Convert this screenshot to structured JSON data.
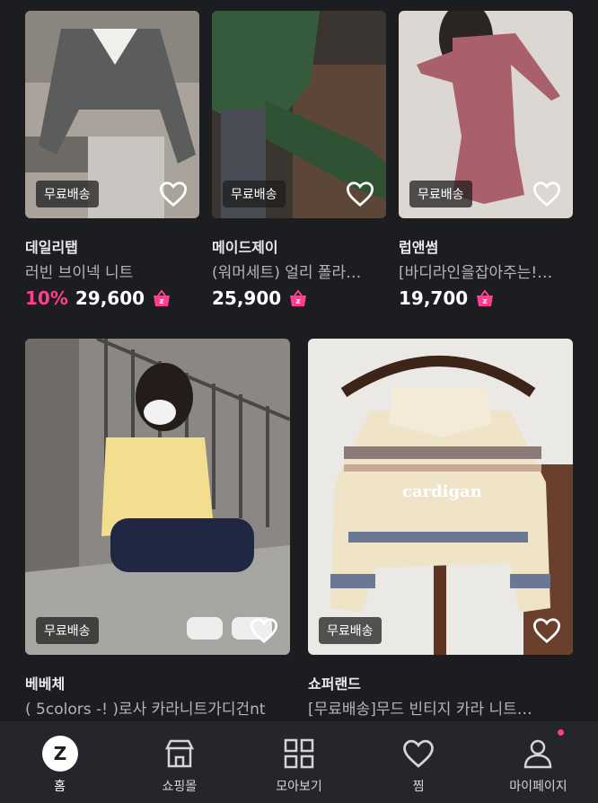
{
  "products": [
    {
      "brand": "데일리탭",
      "title": "러빈 브이넥 니트",
      "discount": "10%",
      "price": "29,600",
      "badge": "무료배송"
    },
    {
      "brand": "메이드제이",
      "title": "(워머세트) 얼리 폴라…",
      "discount": "",
      "price": "25,900",
      "badge": "무료배송"
    },
    {
      "brand": "럽앤썸",
      "title": "[바디라인을잡아주는!…",
      "discount": "",
      "price": "19,700",
      "badge": "무료배송"
    },
    {
      "brand": "베베체",
      "title": "( 5colors -! )로사 카라니트가디건nt",
      "badge": "무료배송"
    },
    {
      "brand": "쇼퍼랜드",
      "title": "[무료배송]무드 빈티지 카라 니트…",
      "badge": "무료배송",
      "image_text": "cardigan"
    }
  ],
  "tabbar": {
    "items": [
      {
        "label": "홈",
        "icon": "home-z-icon"
      },
      {
        "label": "쇼핑몰",
        "icon": "store-icon"
      },
      {
        "label": "모아보기",
        "icon": "grid-icon"
      },
      {
        "label": "찜",
        "icon": "heart-icon"
      },
      {
        "label": "마이페이지",
        "icon": "person-icon"
      }
    ]
  },
  "colors": {
    "accent": "#ff3e8e",
    "background": "#1c1d21",
    "tabbar": "#25262b"
  }
}
